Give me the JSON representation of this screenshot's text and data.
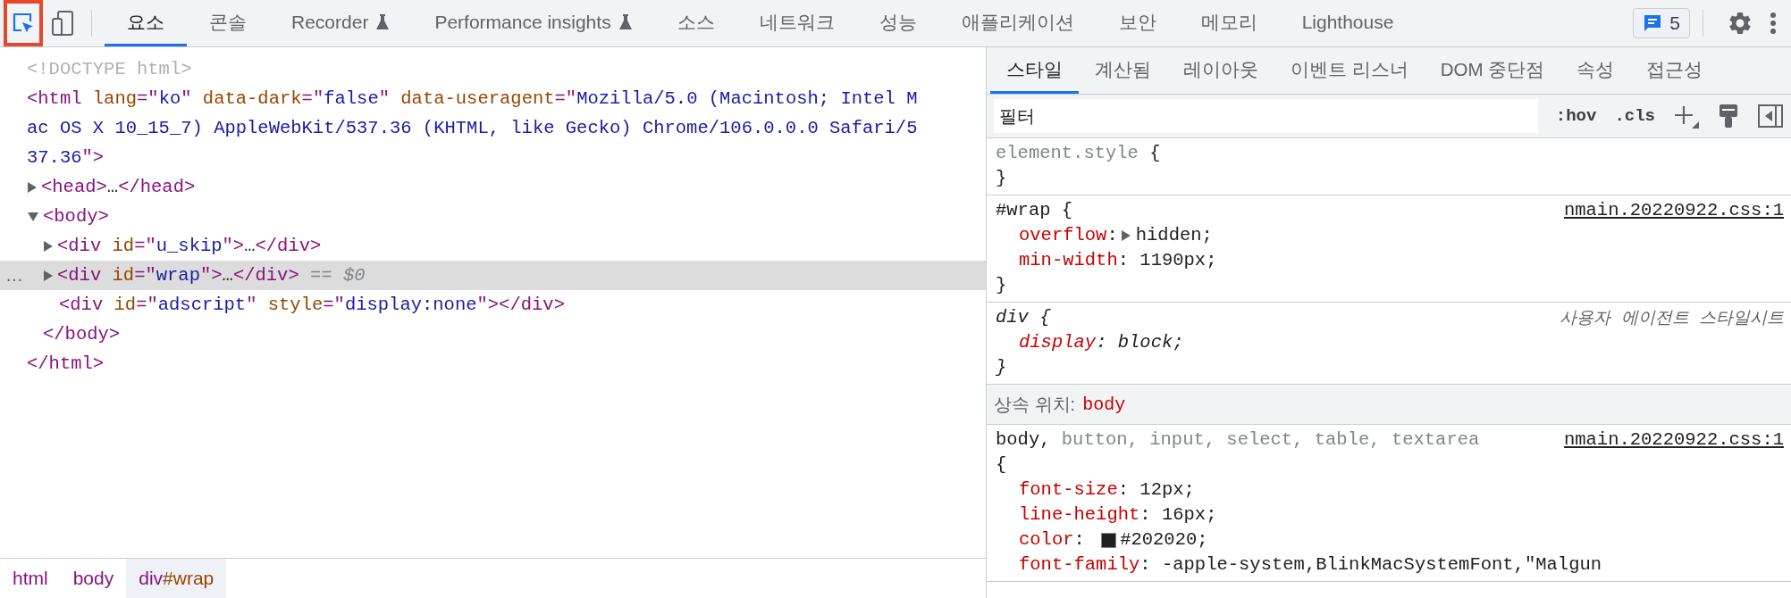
{
  "toolbar": {
    "inspect": {
      "selected": true,
      "highlighted": true
    },
    "device_toggle": {
      "selected": false
    },
    "tabs": [
      {
        "label": "요소",
        "selected": true,
        "experimental": false
      },
      {
        "label": "콘솔",
        "selected": false,
        "experimental": false
      },
      {
        "label": "Recorder",
        "selected": false,
        "experimental": true
      },
      {
        "label": "Performance insights",
        "selected": false,
        "experimental": true
      },
      {
        "label": "소스",
        "selected": false,
        "experimental": false
      },
      {
        "label": "네트워크",
        "selected": false,
        "experimental": false
      },
      {
        "label": "성능",
        "selected": false,
        "experimental": false
      },
      {
        "label": "애플리케이션",
        "selected": false,
        "experimental": false
      },
      {
        "label": "보안",
        "selected": false,
        "experimental": false
      },
      {
        "label": "메모리",
        "selected": false,
        "experimental": false
      },
      {
        "label": "Lighthouse",
        "selected": false,
        "experimental": false
      }
    ],
    "issues": {
      "count": "5"
    }
  },
  "elements": {
    "nodes": [
      {
        "lines": [
          [
            {
              "kind": "comment",
              "text": "<!DOCTYPE html>"
            }
          ]
        ]
      },
      {
        "lines": [
          [
            {
              "kind": "tag",
              "text": "<html "
            },
            {
              "kind": "attr",
              "text": "lang"
            },
            {
              "kind": "tag",
              "text": "=\""
            },
            {
              "kind": "value",
              "text": "ko"
            },
            {
              "kind": "tag",
              "text": "\" "
            },
            {
              "kind": "attr",
              "text": "data-dark"
            },
            {
              "kind": "tag",
              "text": "=\""
            },
            {
              "kind": "value",
              "text": "false"
            },
            {
              "kind": "tag",
              "text": "\" "
            },
            {
              "kind": "attr",
              "text": "data-useragent"
            },
            {
              "kind": "tag",
              "text": "=\""
            },
            {
              "kind": "value",
              "text": "Mozilla/5.0 (Macintosh; Intel M"
            }
          ],
          [
            {
              "kind": "value",
              "text": "ac OS X 10_15_7) AppleWebKit/537.36 (KHTML, like Gecko) Chrome/106.0.0.0 Safari/5"
            }
          ],
          [
            {
              "kind": "value",
              "text": "37.36"
            },
            {
              "kind": "tag",
              "text": "\">"
            }
          ]
        ],
        "children": [
          {
            "expanded": false,
            "lines": [
              [
                {
                  "kind": "tag",
                  "text": "<head>"
                },
                {
                  "kind": "plain",
                  "text": "…"
                },
                {
                  "kind": "tag",
                  "text": "</head>"
                }
              ]
            ]
          },
          {
            "expanded": true,
            "lines": [
              [
                {
                  "kind": "tag",
                  "text": "<body>"
                }
              ]
            ],
            "children": [
              {
                "expanded": false,
                "selected": false,
                "lines": [
                  [
                    {
                      "kind": "tag",
                      "text": "<div "
                    },
                    {
                      "kind": "attr",
                      "text": "id"
                    },
                    {
                      "kind": "tag",
                      "text": "=\""
                    },
                    {
                      "kind": "value",
                      "text": "u_skip"
                    },
                    {
                      "kind": "tag",
                      "text": "\">"
                    },
                    {
                      "kind": "plain",
                      "text": "…"
                    },
                    {
                      "kind": "tag",
                      "text": "</div>"
                    }
                  ]
                ]
              },
              {
                "expanded": false,
                "selected": true,
                "lines": [
                  [
                    {
                      "kind": "tag",
                      "text": "<div "
                    },
                    {
                      "kind": "attr",
                      "text": "id"
                    },
                    {
                      "kind": "tag",
                      "text": "=\""
                    },
                    {
                      "kind": "value",
                      "text": "wrap"
                    },
                    {
                      "kind": "tag",
                      "text": "\">"
                    },
                    {
                      "kind": "plain",
                      "text": "…"
                    },
                    {
                      "kind": "tag",
                      "text": "</div>"
                    },
                    {
                      "kind": "marker",
                      "text": " == $0"
                    }
                  ]
                ]
              },
              {
                "selected": false,
                "lines": [
                  [
                    {
                      "kind": "tag",
                      "text": "<div "
                    },
                    {
                      "kind": "attr",
                      "text": "id"
                    },
                    {
                      "kind": "tag",
                      "text": "=\""
                    },
                    {
                      "kind": "value",
                      "text": "adscript"
                    },
                    {
                      "kind": "tag",
                      "text": "\" "
                    },
                    {
                      "kind": "attr",
                      "text": "style"
                    },
                    {
                      "kind": "tag",
                      "text": "=\""
                    },
                    {
                      "kind": "value",
                      "text": "display:none"
                    },
                    {
                      "kind": "tag",
                      "text": "\"></div>"
                    }
                  ]
                ]
              }
            ],
            "closing": [
              {
                "kind": "tag",
                "text": "</body>"
              }
            ]
          }
        ],
        "closing": [
          {
            "kind": "tag",
            "text": "</html>"
          }
        ]
      }
    ],
    "selected_marker": "…",
    "breadcrumbs": [
      {
        "selected": false,
        "parts": [
          {
            "kind": "tag",
            "text": "html"
          }
        ]
      },
      {
        "selected": false,
        "parts": [
          {
            "kind": "tag",
            "text": "body"
          }
        ]
      },
      {
        "selected": true,
        "parts": [
          {
            "kind": "tag",
            "text": "div"
          },
          {
            "kind": "id",
            "text": "#wrap"
          }
        ]
      }
    ]
  },
  "styles": {
    "tabs": [
      {
        "label": "스타일",
        "selected": true
      },
      {
        "label": "계산됨",
        "selected": false
      },
      {
        "label": "레이아웃",
        "selected": false
      },
      {
        "label": "이벤트 리스너",
        "selected": false
      },
      {
        "label": "DOM 중단점",
        "selected": false
      },
      {
        "label": "속성",
        "selected": false
      },
      {
        "label": "접근성",
        "selected": false
      }
    ],
    "filter": {
      "placeholder": "필터"
    },
    "hov": ":hov",
    "cls": ".cls",
    "sections": [
      {
        "kind": "rule",
        "user_agent": false,
        "selector": [
          {
            "text": "element.style",
            "matched": false
          }
        ],
        "open": "{",
        "close": "}",
        "brace_on_new_line": false
      },
      {
        "kind": "rule",
        "user_agent": false,
        "selector": [
          {
            "text": "#wrap",
            "matched": true
          }
        ],
        "open": "{",
        "close": "}",
        "brace_on_new_line": false,
        "source": "nmain.20220922.css:1",
        "properties": [
          {
            "name": "overflow",
            "colon": ":",
            "value": "hidden;",
            "expandable": true
          },
          {
            "name": "min-width",
            "colon": ":",
            "value": "1190px;",
            "expandable": false
          }
        ]
      },
      {
        "kind": "rule",
        "user_agent": true,
        "selector": [
          {
            "text": "div",
            "matched": true
          }
        ],
        "open": "{",
        "close": "}",
        "brace_on_new_line": false,
        "origin": "사용자 에이전트 스타일시트",
        "properties": [
          {
            "name": "display",
            "colon": ":",
            "value": "block;",
            "expandable": false
          }
        ]
      },
      {
        "kind": "inherited",
        "label": "상속 위치:",
        "node": "body"
      },
      {
        "kind": "rule",
        "user_agent": false,
        "selector": [
          {
            "text": "body,",
            "matched": true
          },
          {
            "text": " button, input, select, table, textarea",
            "matched": false
          }
        ],
        "open": "{",
        "brace_on_new_line": true,
        "source": "nmain.20220922.css:1",
        "properties": [
          {
            "name": "font-size",
            "colon": ":",
            "value": "12px;",
            "expandable": false
          },
          {
            "name": "line-height",
            "colon": ":",
            "value": "16px;",
            "expandable": false
          },
          {
            "name": "color",
            "colon": ":",
            "value": "#202020;",
            "expandable": false,
            "swatch": true
          },
          {
            "name": "font-family",
            "colon": ":",
            "value": "-apple-system,BlinkMacSystemFont,\"Malgun",
            "expandable": false
          }
        ]
      }
    ]
  }
}
